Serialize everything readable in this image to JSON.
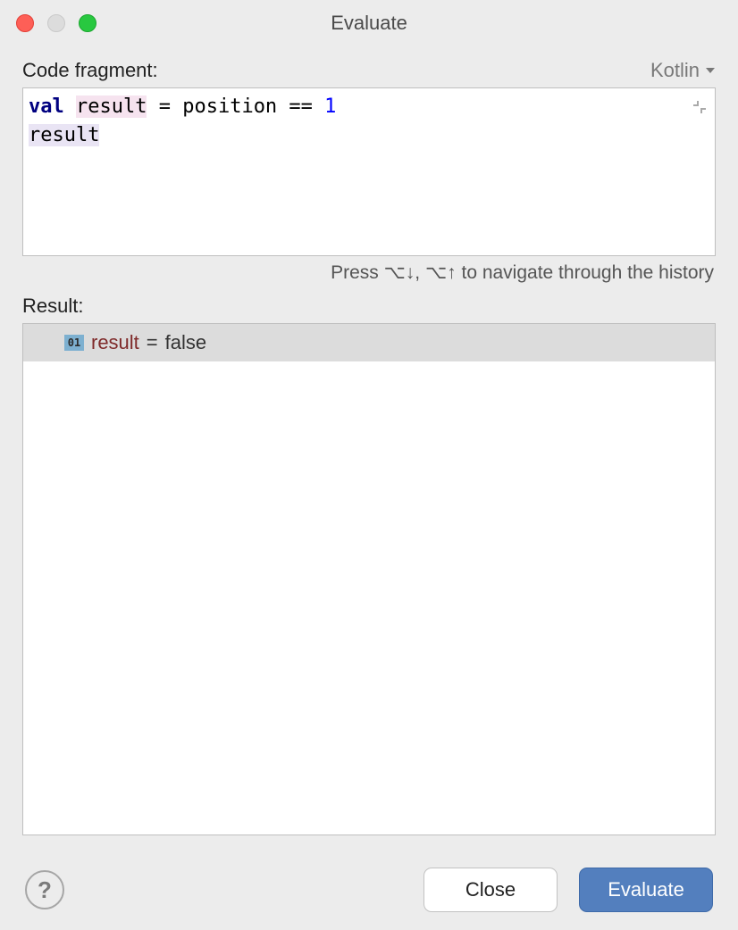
{
  "window": {
    "title": "Evaluate"
  },
  "labels": {
    "code_fragment": "Code fragment:",
    "result": "Result:"
  },
  "language": {
    "selected": "Kotlin"
  },
  "code": {
    "tokens": [
      {
        "cls": "kw",
        "text": "val"
      },
      {
        "cls": "",
        "text": " "
      },
      {
        "cls": "hl1",
        "text": "result"
      },
      {
        "cls": "",
        "text": " = position == "
      },
      {
        "cls": "num",
        "text": "1"
      },
      {
        "cls": "",
        "text": "\n"
      },
      {
        "cls": "hl2",
        "text": "result"
      }
    ]
  },
  "hint": "Press ⌥↓, ⌥↑ to navigate through the history",
  "result": {
    "badge": "01",
    "var_name": "result",
    "equals": " = ",
    "value": "false"
  },
  "buttons": {
    "close": "Close",
    "evaluate": "Evaluate",
    "help": "?"
  }
}
